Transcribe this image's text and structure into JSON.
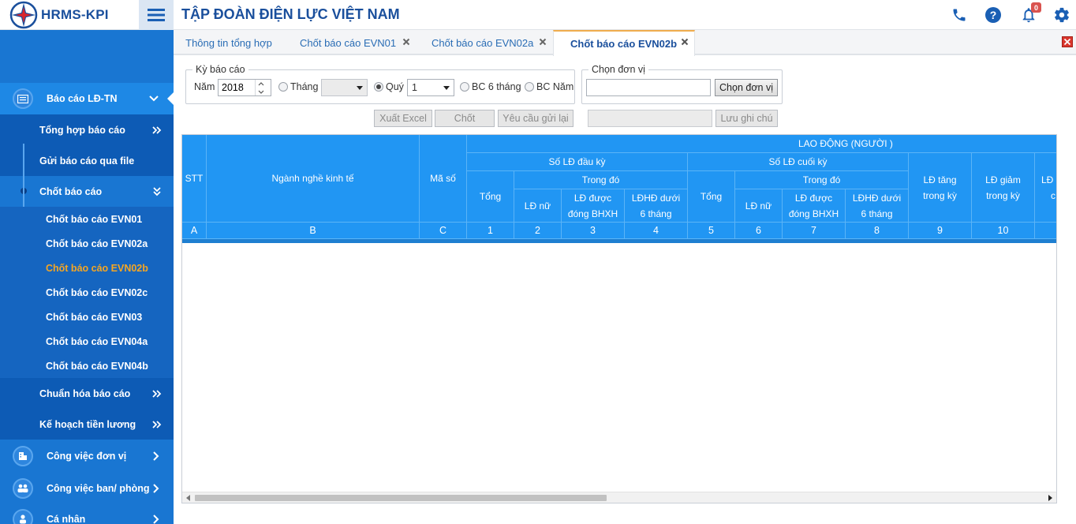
{
  "app": {
    "brand": "HRMS-KPI",
    "corp_title": "TẬP ĐOÀN ĐIỆN LỰC VIỆT NAM",
    "notification_count": "0"
  },
  "colors": {
    "primary": "#1565c0",
    "accent": "#f5a623",
    "header": "#2196f3"
  },
  "sidebar": {
    "main": {
      "label": "Báo cáo LĐ-TN",
      "icon": "report-icon"
    },
    "subs": [
      {
        "label": "Tổng hợp báo cáo"
      },
      {
        "label": "Gửi báo cáo qua file"
      },
      {
        "label": "Chốt báo cáo"
      }
    ],
    "leaves": [
      {
        "label": "Chốt báo cáo EVN01"
      },
      {
        "label": "Chốt báo cáo EVN02a"
      },
      {
        "label": "Chốt báo cáo EVN02b"
      },
      {
        "label": "Chốt báo cáo EVN02c"
      },
      {
        "label": "Chốt báo cáo EVN03"
      },
      {
        "label": "Chốt báo cáo EVN04a"
      },
      {
        "label": "Chốt báo cáo EVN04b"
      }
    ],
    "subs2": [
      {
        "label": "Chuẩn hóa báo cáo"
      },
      {
        "label": "Kế hoạch tiền lương"
      }
    ],
    "lvl1": [
      {
        "label": "Công việc đơn vị",
        "icon": "building-icon"
      },
      {
        "label": "Công việc ban/ phòng",
        "icon": "group-icon"
      },
      {
        "label": "Cá nhân",
        "icon": "person-icon"
      }
    ]
  },
  "tabs": [
    {
      "label": "Thông tin tổng hợp"
    },
    {
      "label": "Chốt báo cáo EVN01"
    },
    {
      "label": "Chốt báo cáo EVN02a"
    },
    {
      "label": "Chốt báo cáo EVN02b"
    }
  ],
  "filters": {
    "period_legend": "Kỳ báo cáo",
    "year_label": "Năm",
    "year_value": "2018",
    "month_label": "Tháng",
    "month_value": "",
    "quarter_label": "Quý",
    "quarter_value": "1",
    "half_year_label": "BC 6 tháng",
    "annual_label": "BC Năm",
    "selected_period": "Quý",
    "unit_legend": "Chọn đơn vị",
    "unit_value": "",
    "choose_unit_button": "Chọn đơn vị"
  },
  "actions": {
    "export_excel": "Xuất Excel",
    "close_report": "Chốt",
    "resend_request": "Yêu cầu gửi lại",
    "note_value": "",
    "save_note": "Lưu ghi chú"
  },
  "grid": {
    "stt": "STT",
    "industry": "Ngành nghề kinh tế",
    "code": "Mã số",
    "labor_group": "LAO ĐỘNG (NGƯỜI )",
    "start_group": "Số LĐ đầu kỳ",
    "end_group": "Số LĐ cuối kỳ",
    "of_which": "Trong đó",
    "total": "Tổng",
    "female": "LĐ nữ",
    "insured": "LĐ được đóng BHXH",
    "under6": "LĐHĐ dưới 6 tháng",
    "increase": "LĐ tăng trong kỳ",
    "decrease": "LĐ giảm trong kỳ",
    "partial": "LĐ",
    "partial2": "c",
    "col_codes": [
      "A",
      "B",
      "C",
      "1",
      "2",
      "3",
      "4",
      "5",
      "6",
      "7",
      "8",
      "9",
      "10"
    ]
  }
}
